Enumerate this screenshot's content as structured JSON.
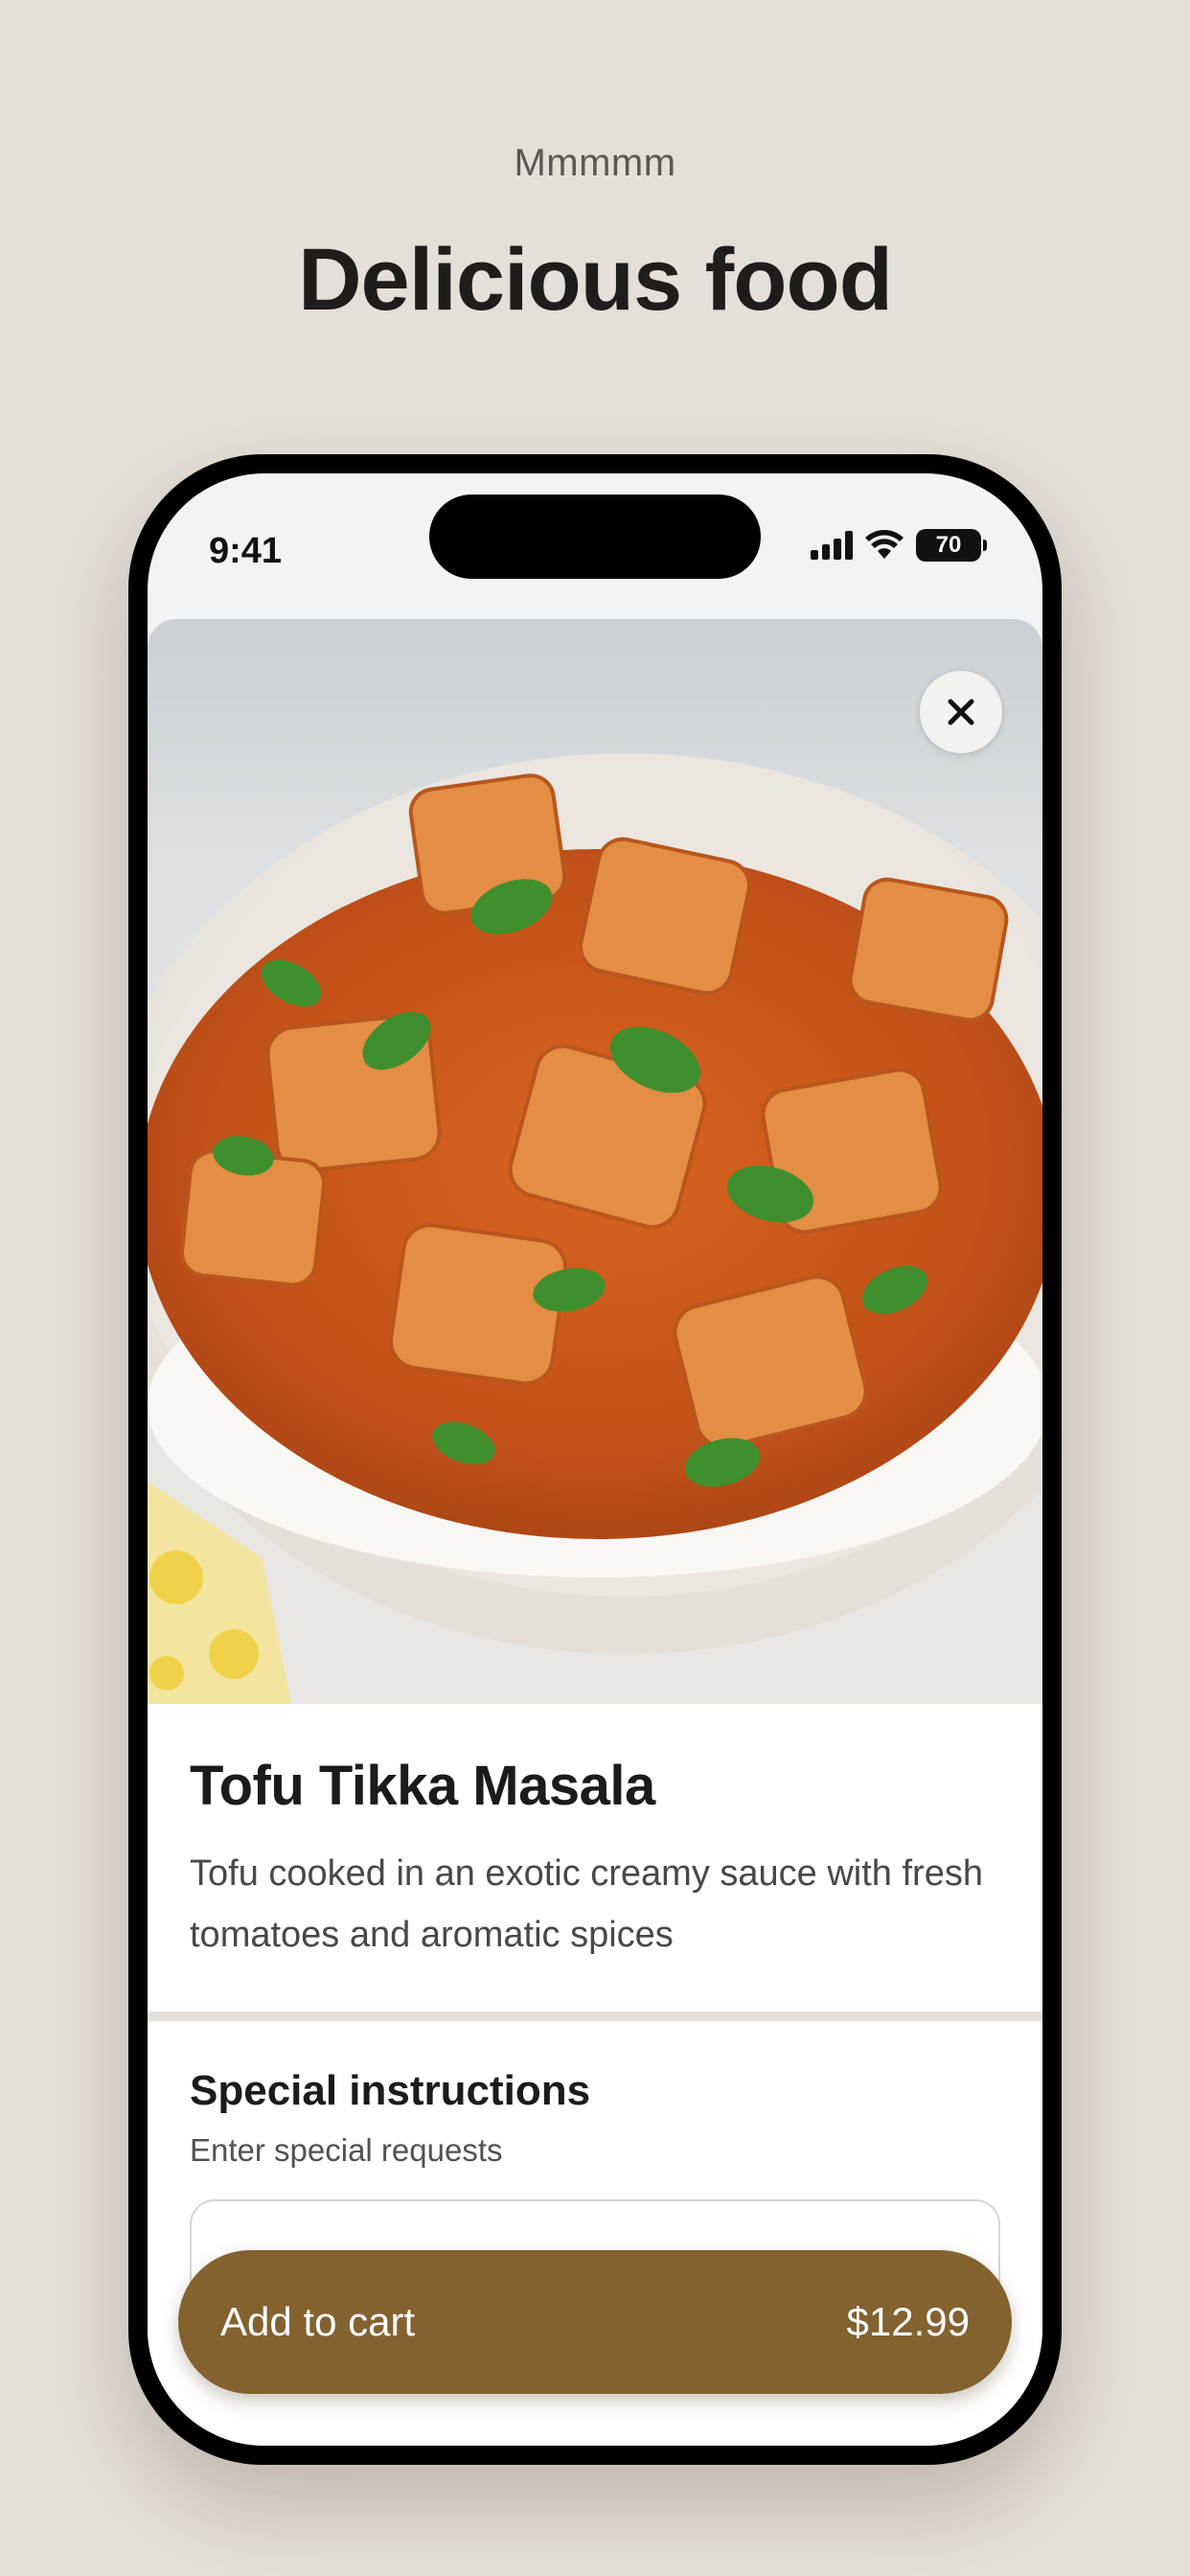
{
  "header": {
    "eyebrow": "Mmmmm",
    "title": "Delicious food"
  },
  "status_bar": {
    "time": "9:41",
    "battery": "70",
    "icons": [
      "signal-icon",
      "wifi-icon",
      "battery-icon"
    ]
  },
  "dish": {
    "image_icon": "food-photo",
    "name": "Tofu Tikka Masala",
    "description": "Tofu cooked in an exotic creamy sauce with fresh tomatoes and aromatic spices"
  },
  "special_instructions": {
    "title": "Special instructions",
    "subtitle": "Enter special requests",
    "value": ""
  },
  "cart": {
    "label": "Add to cart",
    "price": "$12.99"
  },
  "colors": {
    "background": "#e4dfd9",
    "accent": "#836230",
    "text": "#1c1b1a"
  }
}
